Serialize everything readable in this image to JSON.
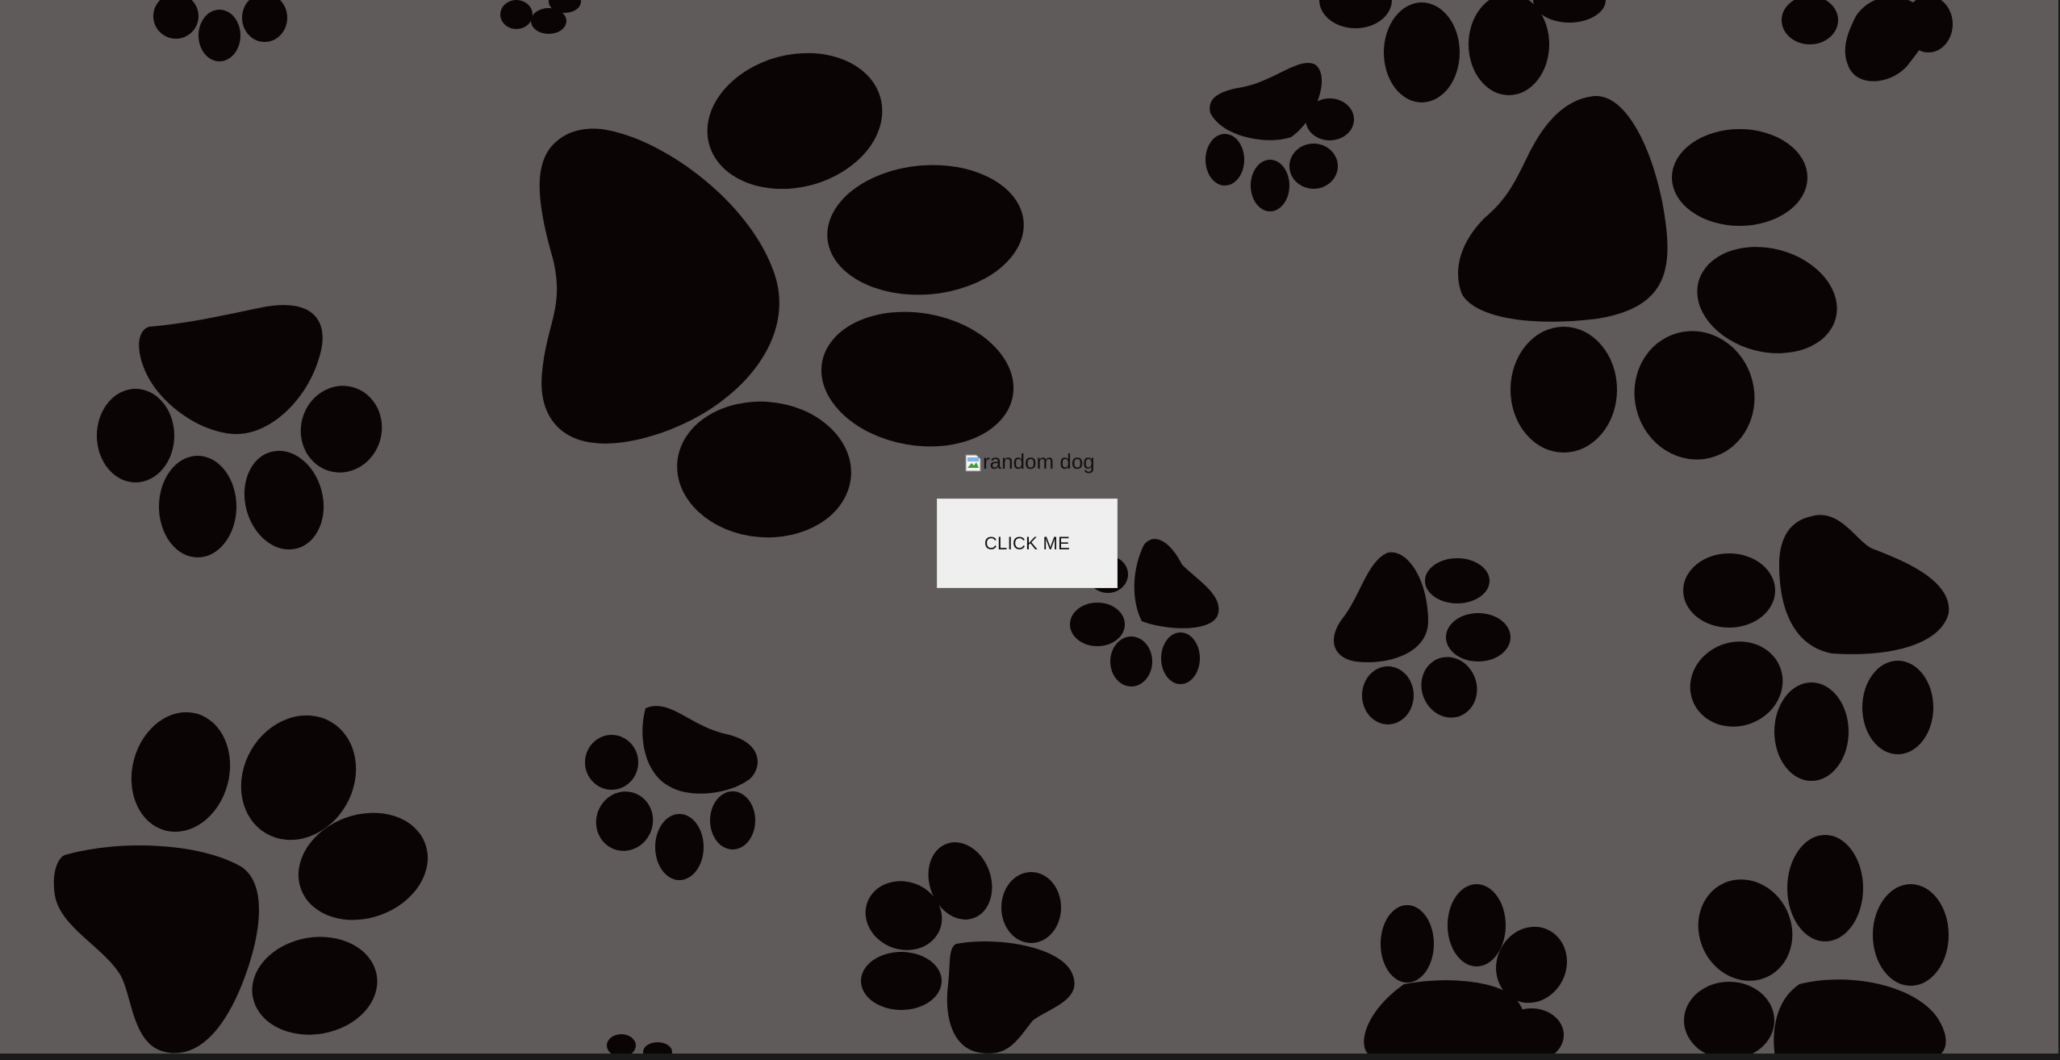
{
  "page": {
    "background_color": "#5f5b5b",
    "pattern": "paw-prints",
    "pattern_color": "#0b0404"
  },
  "image": {
    "alt": "random dog",
    "icon": "broken-image-icon"
  },
  "button": {
    "label": "CLICK ME"
  }
}
